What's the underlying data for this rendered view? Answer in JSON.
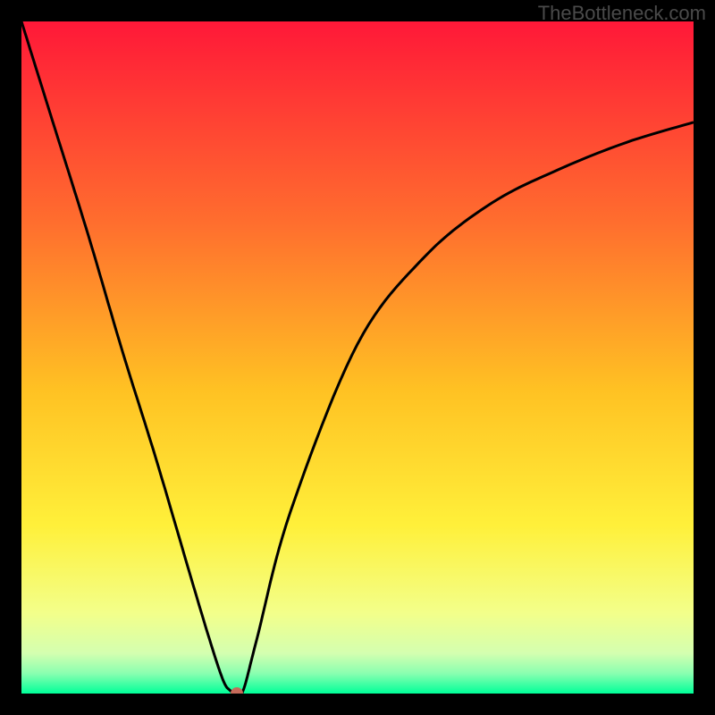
{
  "watermark": "TheBottleneck.com",
  "chart_data": {
    "type": "line",
    "title": "",
    "xlabel": "",
    "ylabel": "",
    "x": [
      0,
      5,
      10,
      15,
      20,
      25,
      28,
      30,
      31,
      32,
      33,
      35,
      40,
      50,
      60,
      70,
      80,
      90,
      100
    ],
    "values": [
      100,
      84,
      68,
      51,
      35,
      18,
      8,
      2,
      0.5,
      0,
      0.5,
      8,
      27,
      52,
      65,
      73,
      78,
      82,
      85
    ],
    "xlim": [
      0,
      100
    ],
    "ylim": [
      0,
      100
    ],
    "marker": {
      "x": 32,
      "y": 0
    },
    "gradient_stops": [
      {
        "offset": 0,
        "color": "#ff1838"
      },
      {
        "offset": 30,
        "color": "#ff6e2e"
      },
      {
        "offset": 55,
        "color": "#ffc223"
      },
      {
        "offset": 75,
        "color": "#fff03a"
      },
      {
        "offset": 88,
        "color": "#f3ff8a"
      },
      {
        "offset": 94,
        "color": "#d4ffb0"
      },
      {
        "offset": 97,
        "color": "#8affb0"
      },
      {
        "offset": 100,
        "color": "#00ff99"
      }
    ]
  }
}
